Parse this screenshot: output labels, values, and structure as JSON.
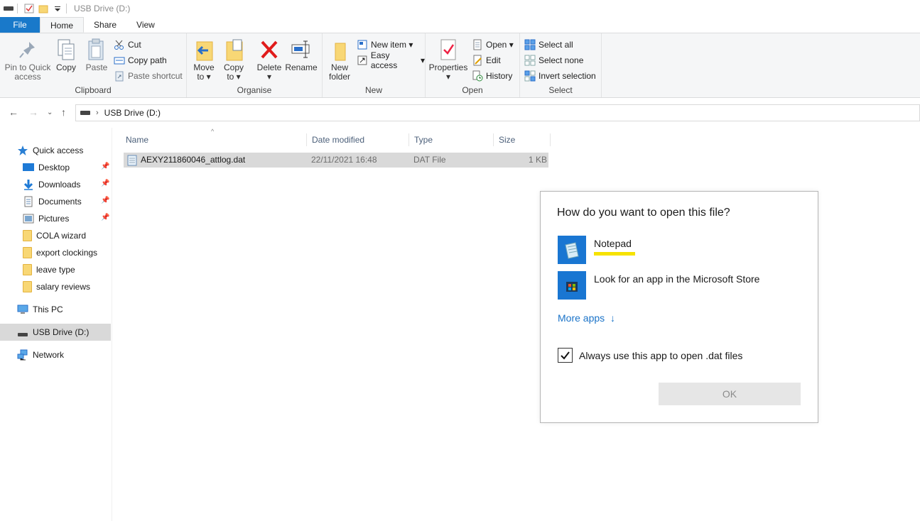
{
  "window": {
    "title": "USB Drive (D:)"
  },
  "tabs": [
    {
      "label": "File"
    },
    {
      "label": "Home"
    },
    {
      "label": "Share"
    },
    {
      "label": "View"
    }
  ],
  "ribbon": {
    "clipboard": {
      "label": "Clipboard",
      "pin": "Pin to Quick",
      "pin2": "access",
      "copy": "Copy",
      "paste": "Paste",
      "cut": "Cut",
      "copy_path": "Copy path",
      "paste_shortcut": "Paste shortcut"
    },
    "organise": {
      "label": "Organise",
      "move_to": "Move",
      "move_to2": "to",
      "copy_to": "Copy",
      "copy_to2": "to",
      "delete": "Delete",
      "rename": "Rename"
    },
    "new": {
      "label": "New",
      "new_folder": "New",
      "new_folder2": "folder",
      "new_item": "New item",
      "easy_access": "Easy access"
    },
    "open": {
      "label": "Open",
      "properties": "Properties",
      "open": "Open",
      "edit": "Edit",
      "history": "History"
    },
    "select": {
      "label": "Select",
      "select_all": "Select all",
      "select_none": "Select none",
      "invert": "Invert selection"
    }
  },
  "address": {
    "path": "USB Drive (D:)"
  },
  "sidebar": {
    "items": [
      {
        "label": "Quick access"
      },
      {
        "label": "Desktop"
      },
      {
        "label": "Downloads"
      },
      {
        "label": "Documents"
      },
      {
        "label": "Pictures"
      },
      {
        "label": "COLA wizard"
      },
      {
        "label": "export clockings"
      },
      {
        "label": "leave type"
      },
      {
        "label": "salary reviews"
      },
      {
        "label": "This PC"
      },
      {
        "label": "USB Drive (D:)"
      },
      {
        "label": "Network"
      }
    ]
  },
  "columns": [
    "Name",
    "Date modified",
    "Type",
    "Size"
  ],
  "files": [
    {
      "name": "AEXY211860046_attlog.dat",
      "modified": "22/11/2021 16:48",
      "type": "DAT File",
      "size": "1 KB"
    }
  ],
  "dialog": {
    "title": "How do you want to open this file?",
    "apps": [
      {
        "name": "Notepad"
      },
      {
        "name": "Look for an app in the Microsoft Store"
      }
    ],
    "more_apps": "More apps",
    "more_apps_arrow": "↓",
    "always_use": "Always use this app to open .dat files",
    "always_checked": true,
    "ok": "OK"
  },
  "colors": {
    "accent": "#1979ca",
    "link": "#1a73c8",
    "highlight": "#f6e200"
  }
}
